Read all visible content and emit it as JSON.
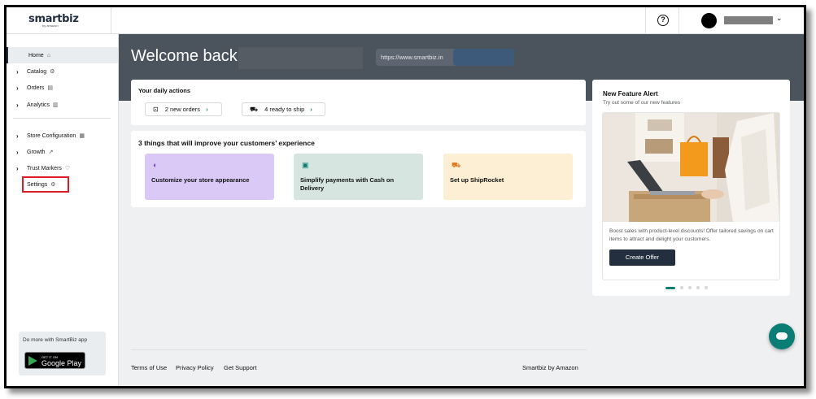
{
  "brand": {
    "logo": "smartbiz",
    "logo_sub": "by amazon"
  },
  "header": {
    "help_icon": "?",
    "user_menu_icon": "chevron-down"
  },
  "sidebar": {
    "items": [
      {
        "label": "Home",
        "icon": "⌂"
      },
      {
        "label": "Catalog",
        "icon": "⚙"
      },
      {
        "label": "Orders",
        "icon": "▤"
      },
      {
        "label": "Analytics",
        "icon": "▥"
      },
      {
        "label": "Store Configuration",
        "icon": "▦"
      },
      {
        "label": "Growth",
        "icon": "↗"
      },
      {
        "label": "Trust Markers",
        "icon": "♡"
      },
      {
        "label": "Settings",
        "icon": "⚙"
      }
    ],
    "app_promo": "Do more with SmartBiz app",
    "gplay_top": "GET IT ON",
    "gplay_name": "Google Play"
  },
  "hero": {
    "welcome": "Welcome back,",
    "url": "https://www.smartbiz.in"
  },
  "daily": {
    "title": "Your daily actions",
    "chips": [
      {
        "label": "2 new orders",
        "arrow": "›"
      },
      {
        "label": "4 ready to ship",
        "arrow": "›"
      }
    ]
  },
  "improve": {
    "title": "3 things that will improve your customers’ experience",
    "tiles": [
      {
        "label": "Customize your store appearance",
        "color": "#dac9f6",
        "icon_color": "#6b3fd1"
      },
      {
        "label": "Simplify payments with Cash on Delivery",
        "color": "#d6e5df",
        "icon_color": "#0a7d75"
      },
      {
        "label": "Set up ShipRocket",
        "color": "#fdefd3",
        "icon_color": "#e07a1f"
      }
    ]
  },
  "feature": {
    "title": "New Feature Alert",
    "subtitle": "Try out some of our new features",
    "description": "Boost sales with product-level discounts! Offer tailored savings on cart items to attract and delight your customers.",
    "button": "Create Offer"
  },
  "footer": {
    "terms": "Terms of Use",
    "privacy": "Privacy Policy",
    "support": "Get Support",
    "brand": "Smartbiz by Amazon"
  },
  "colors": {
    "accent": "#0a7d75",
    "dark": "#232f3e",
    "hero": "#4b545d",
    "highlight": "#e01b22"
  }
}
